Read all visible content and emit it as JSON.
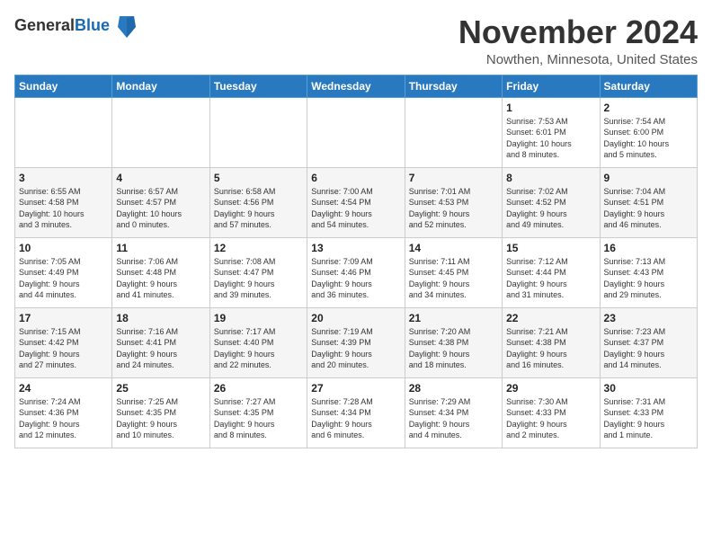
{
  "logo": {
    "general": "General",
    "blue": "Blue"
  },
  "title": "November 2024",
  "location": "Nowthen, Minnesota, United States",
  "days_of_week": [
    "Sunday",
    "Monday",
    "Tuesday",
    "Wednesday",
    "Thursday",
    "Friday",
    "Saturday"
  ],
  "weeks": [
    [
      {
        "day": "",
        "info": ""
      },
      {
        "day": "",
        "info": ""
      },
      {
        "day": "",
        "info": ""
      },
      {
        "day": "",
        "info": ""
      },
      {
        "day": "",
        "info": ""
      },
      {
        "day": "1",
        "info": "Sunrise: 7:53 AM\nSunset: 6:01 PM\nDaylight: 10 hours\nand 8 minutes."
      },
      {
        "day": "2",
        "info": "Sunrise: 7:54 AM\nSunset: 6:00 PM\nDaylight: 10 hours\nand 5 minutes."
      }
    ],
    [
      {
        "day": "3",
        "info": "Sunrise: 6:55 AM\nSunset: 4:58 PM\nDaylight: 10 hours\nand 3 minutes."
      },
      {
        "day": "4",
        "info": "Sunrise: 6:57 AM\nSunset: 4:57 PM\nDaylight: 10 hours\nand 0 minutes."
      },
      {
        "day": "5",
        "info": "Sunrise: 6:58 AM\nSunset: 4:56 PM\nDaylight: 9 hours\nand 57 minutes."
      },
      {
        "day": "6",
        "info": "Sunrise: 7:00 AM\nSunset: 4:54 PM\nDaylight: 9 hours\nand 54 minutes."
      },
      {
        "day": "7",
        "info": "Sunrise: 7:01 AM\nSunset: 4:53 PM\nDaylight: 9 hours\nand 52 minutes."
      },
      {
        "day": "8",
        "info": "Sunrise: 7:02 AM\nSunset: 4:52 PM\nDaylight: 9 hours\nand 49 minutes."
      },
      {
        "day": "9",
        "info": "Sunrise: 7:04 AM\nSunset: 4:51 PM\nDaylight: 9 hours\nand 46 minutes."
      }
    ],
    [
      {
        "day": "10",
        "info": "Sunrise: 7:05 AM\nSunset: 4:49 PM\nDaylight: 9 hours\nand 44 minutes."
      },
      {
        "day": "11",
        "info": "Sunrise: 7:06 AM\nSunset: 4:48 PM\nDaylight: 9 hours\nand 41 minutes."
      },
      {
        "day": "12",
        "info": "Sunrise: 7:08 AM\nSunset: 4:47 PM\nDaylight: 9 hours\nand 39 minutes."
      },
      {
        "day": "13",
        "info": "Sunrise: 7:09 AM\nSunset: 4:46 PM\nDaylight: 9 hours\nand 36 minutes."
      },
      {
        "day": "14",
        "info": "Sunrise: 7:11 AM\nSunset: 4:45 PM\nDaylight: 9 hours\nand 34 minutes."
      },
      {
        "day": "15",
        "info": "Sunrise: 7:12 AM\nSunset: 4:44 PM\nDaylight: 9 hours\nand 31 minutes."
      },
      {
        "day": "16",
        "info": "Sunrise: 7:13 AM\nSunset: 4:43 PM\nDaylight: 9 hours\nand 29 minutes."
      }
    ],
    [
      {
        "day": "17",
        "info": "Sunrise: 7:15 AM\nSunset: 4:42 PM\nDaylight: 9 hours\nand 27 minutes."
      },
      {
        "day": "18",
        "info": "Sunrise: 7:16 AM\nSunset: 4:41 PM\nDaylight: 9 hours\nand 24 minutes."
      },
      {
        "day": "19",
        "info": "Sunrise: 7:17 AM\nSunset: 4:40 PM\nDaylight: 9 hours\nand 22 minutes."
      },
      {
        "day": "20",
        "info": "Sunrise: 7:19 AM\nSunset: 4:39 PM\nDaylight: 9 hours\nand 20 minutes."
      },
      {
        "day": "21",
        "info": "Sunrise: 7:20 AM\nSunset: 4:38 PM\nDaylight: 9 hours\nand 18 minutes."
      },
      {
        "day": "22",
        "info": "Sunrise: 7:21 AM\nSunset: 4:38 PM\nDaylight: 9 hours\nand 16 minutes."
      },
      {
        "day": "23",
        "info": "Sunrise: 7:23 AM\nSunset: 4:37 PM\nDaylight: 9 hours\nand 14 minutes."
      }
    ],
    [
      {
        "day": "24",
        "info": "Sunrise: 7:24 AM\nSunset: 4:36 PM\nDaylight: 9 hours\nand 12 minutes."
      },
      {
        "day": "25",
        "info": "Sunrise: 7:25 AM\nSunset: 4:35 PM\nDaylight: 9 hours\nand 10 minutes."
      },
      {
        "day": "26",
        "info": "Sunrise: 7:27 AM\nSunset: 4:35 PM\nDaylight: 9 hours\nand 8 minutes."
      },
      {
        "day": "27",
        "info": "Sunrise: 7:28 AM\nSunset: 4:34 PM\nDaylight: 9 hours\nand 6 minutes."
      },
      {
        "day": "28",
        "info": "Sunrise: 7:29 AM\nSunset: 4:34 PM\nDaylight: 9 hours\nand 4 minutes."
      },
      {
        "day": "29",
        "info": "Sunrise: 7:30 AM\nSunset: 4:33 PM\nDaylight: 9 hours\nand 2 minutes."
      },
      {
        "day": "30",
        "info": "Sunrise: 7:31 AM\nSunset: 4:33 PM\nDaylight: 9 hours\nand 1 minute."
      }
    ]
  ]
}
